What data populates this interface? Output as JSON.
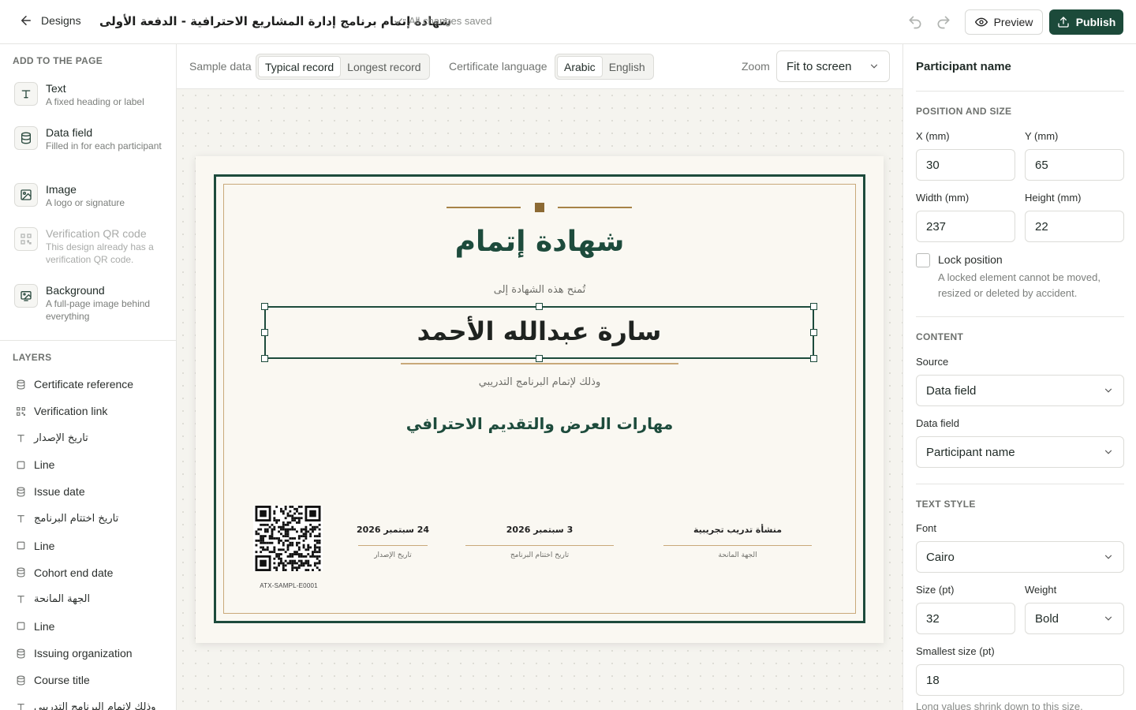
{
  "topbar": {
    "back_label": "Designs",
    "doc_title": "شهادة إتمام برنامج إدارة المشاريع الاحترافية - الدفعة الأولى",
    "save_status": "All changes saved",
    "preview_label": "Preview",
    "publish_label": "Publish"
  },
  "left": {
    "add_heading": "ADD TO THE PAGE",
    "add_items": [
      {
        "title": "Text",
        "desc": "A fixed heading or label",
        "icon": "text-icon"
      },
      {
        "title": "Data field",
        "desc": "Filled in for each participant",
        "icon": "database-icon"
      },
      {
        "title": "Image",
        "desc": "A logo or signature",
        "icon": "image-icon"
      },
      {
        "title": "Verification QR code",
        "desc": "This design already has a verification QR code.",
        "icon": "qr-code-icon",
        "disabled": true
      },
      {
        "title": "Background",
        "desc": "A full-page image behind everything",
        "icon": "background-image-icon"
      }
    ],
    "layers_heading": "LAYERS",
    "layers": [
      {
        "label": "Certificate reference",
        "icon": "database-icon"
      },
      {
        "label": "Verification link",
        "icon": "qr-code-icon"
      },
      {
        "label": "تاريخ الإصدار",
        "icon": "text-icon"
      },
      {
        "label": "Line",
        "icon": "rectangle-icon"
      },
      {
        "label": "Issue date",
        "icon": "database-icon"
      },
      {
        "label": "تاريخ اختتام البرنامج",
        "icon": "text-icon"
      },
      {
        "label": "Line",
        "icon": "rectangle-icon"
      },
      {
        "label": "Cohort end date",
        "icon": "database-icon"
      },
      {
        "label": "الجهة المانحة",
        "icon": "text-icon"
      },
      {
        "label": "Line",
        "icon": "rectangle-icon"
      },
      {
        "label": "Issuing organization",
        "icon": "database-icon"
      },
      {
        "label": "Course title",
        "icon": "database-icon"
      },
      {
        "label": "وذلك لإتمام البرنامج التدريبي",
        "icon": "text-icon"
      }
    ]
  },
  "toolbar": {
    "sample_label": "Sample data",
    "sample_options": [
      "Typical record",
      "Longest record"
    ],
    "sample_selected": "Typical record",
    "language_label": "Certificate language",
    "language_options": [
      "Arabic",
      "English"
    ],
    "language_selected": "Arabic",
    "zoom_label": "Zoom",
    "zoom_value": "Fit to screen"
  },
  "certificate": {
    "title": "شهادة إتمام",
    "granted_to": "تُمنح هذه الشهادة إلى",
    "participant_name": "سارة عبدالله الأحمد",
    "for_completing": "وذلك لإتمام البرنامج التدريبي",
    "course_title": "مهارات العرض والتقديم الاحترافي",
    "reference": "ATX-SAMPL-E0001",
    "signatures": [
      {
        "value": "24 سبتمبر 2026",
        "label": "تاريخ الإصدار"
      },
      {
        "value": "3 سبتمبر 2026",
        "label": "تاريخ اختتام البرنامج"
      },
      {
        "value": "منشأة تدريب تجريبية",
        "label": "الجهة المانحة"
      }
    ],
    "colors": {
      "primary": "#1d4b3c",
      "gold": "#c9a97a",
      "paper": "#faf8f2"
    }
  },
  "right": {
    "title": "Participant name",
    "position_heading": "POSITION AND SIZE",
    "x_label": "X (mm)",
    "x_value": "30",
    "y_label": "Y (mm)",
    "y_value": "65",
    "w_label": "Width (mm)",
    "w_value": "237",
    "h_label": "Height (mm)",
    "h_value": "22",
    "lock_label": "Lock position",
    "lock_checked": false,
    "lock_help": "A locked element cannot be moved, resized or deleted by accident.",
    "content_heading": "CONTENT",
    "source_label": "Source",
    "source_value": "Data field",
    "field_label": "Data field",
    "field_value": "Participant name",
    "style_heading": "TEXT STYLE",
    "font_label": "Font",
    "font_value": "Cairo",
    "size_label": "Size (pt)",
    "size_value": "32",
    "weight_label": "Weight",
    "weight_value": "Bold",
    "smallest_label": "Smallest size (pt)",
    "smallest_value": "18",
    "hint": "Long values shrink down to this size."
  }
}
